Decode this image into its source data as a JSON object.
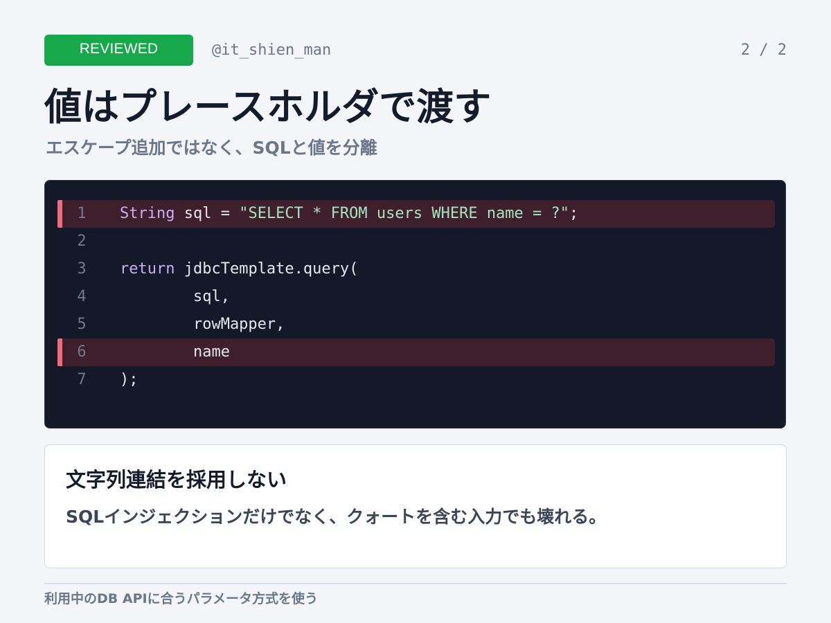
{
  "header": {
    "badge": "REVIEWED",
    "handle": "@it_shien_man",
    "pager": "2 / 2"
  },
  "title": "値はプレースホルダで渡す",
  "subtitle": "エスケープ追加ではなく、SQLと値を分離",
  "code": {
    "lines": [
      {
        "number": "1",
        "highlighted": true,
        "tokens": [
          {
            "text": "String",
            "kind": "kw"
          },
          {
            "text": " sql = ",
            "kind": "plain"
          },
          {
            "text": "\"SELECT * FROM users WHERE name = ?\"",
            "kind": "str"
          },
          {
            "text": ";",
            "kind": "plain"
          }
        ]
      },
      {
        "number": "2",
        "highlighted": false,
        "tokens": []
      },
      {
        "number": "3",
        "highlighted": false,
        "tokens": [
          {
            "text": "return",
            "kind": "kw"
          },
          {
            "text": " jdbcTemplate.query(",
            "kind": "plain"
          }
        ]
      },
      {
        "number": "4",
        "highlighted": false,
        "tokens": [
          {
            "text": "        sql,",
            "kind": "plain"
          }
        ]
      },
      {
        "number": "5",
        "highlighted": false,
        "tokens": [
          {
            "text": "        rowMapper,",
            "kind": "plain"
          }
        ]
      },
      {
        "number": "6",
        "highlighted": true,
        "tokens": [
          {
            "text": "        name",
            "kind": "plain"
          }
        ]
      },
      {
        "number": "7",
        "highlighted": false,
        "tokens": [
          {
            "text": ");",
            "kind": "plain"
          }
        ]
      }
    ]
  },
  "note": {
    "heading": "文字列連結を採用しない",
    "body": "SQLインジェクションだけでなく、クォートを含む入力でも壊れる。"
  },
  "footer": "利用中のDB APIに合うパラメータ方式を使う",
  "colors": {
    "badge": "#17a84b",
    "highlight_bar": "#ef6b7b",
    "highlight_bg": "#3f1f2b",
    "keyword": "#c9aef2",
    "string": "#a5e3c3"
  }
}
